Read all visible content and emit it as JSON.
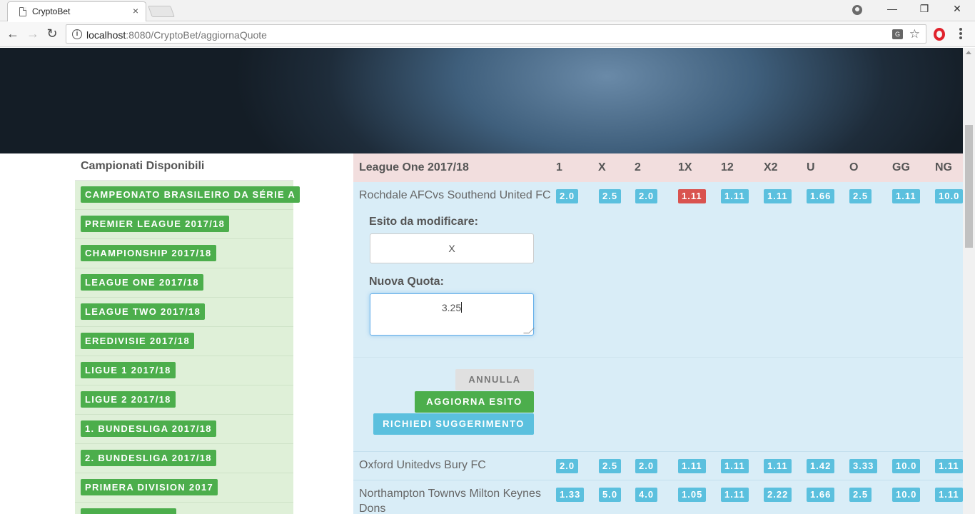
{
  "browser": {
    "tab_title": "CryptoBet",
    "tab_close": "×",
    "url_host": "localhost",
    "url_rest": ":8080/CryptoBet/aggiornaQuote",
    "minimize": "—",
    "restore": "❐",
    "close": "✕",
    "back": "←",
    "forward": "→",
    "reload": "↻",
    "info": "i",
    "translate": "G",
    "star": "☆"
  },
  "sidebar": {
    "title": "Campionati Disponibili",
    "items": [
      "CAMPEONATO BRASILEIRO DA SÉRIE A",
      "PREMIER LEAGUE 2017/18",
      "CHAMPIONSHIP 2017/18",
      "LEAGUE ONE 2017/18",
      "LEAGUE TWO 2017/18",
      "EREDIVISIE 2017/18",
      "LIGUE 1 2017/18",
      "LIGUE 2 2017/18",
      "1. BUNDESLIGA 2017/18",
      "2. BUNDESLIGA 2017/18",
      "PRIMERA DIVISION 2017",
      ""
    ]
  },
  "table": {
    "league_title": "League One 2017/18",
    "columns": [
      "1",
      "X",
      "2",
      "1X",
      "12",
      "X2",
      "U",
      "O",
      "GG",
      "NG"
    ],
    "matches": [
      {
        "name": "Rochdale AFCvs Southend United FC",
        "odds": [
          "2.0",
          "2.5",
          "2.0",
          "1.11",
          "1.11",
          "1.11",
          "1.66",
          "2.5",
          "1.11",
          "10.0"
        ]
      },
      {
        "name": "Oxford Unitedvs Bury FC",
        "odds": [
          "2.0",
          "2.5",
          "2.0",
          "1.11",
          "1.11",
          "1.11",
          "1.42",
          "3.33",
          "10.0",
          "1.11"
        ]
      },
      {
        "name_line1": "Northampton Townvs Milton Keynes",
        "name_line2": "Dons",
        "odds": [
          "1.33",
          "5.0",
          "4.0",
          "1.05",
          "1.11",
          "2.22",
          "1.66",
          "2.5",
          "10.0",
          "1.11"
        ]
      }
    ],
    "highlighted_odd": "1X",
    "colors": {
      "odd_badge": "#5bc0de",
      "odd_selected": "#d9534f",
      "header_bg": "#f2dede",
      "row_bg": "#d9edf7"
    }
  },
  "edit_form": {
    "esito_label": "Esito da modificare:",
    "esito_value": "X",
    "quota_label": "Nuova Quota:",
    "quota_value": "3.25",
    "cancel_label": "ANNULLA",
    "update_label": "AGGIORNA ESITO",
    "suggest_label": "RICHIEDI SUGGERIMENTO"
  }
}
